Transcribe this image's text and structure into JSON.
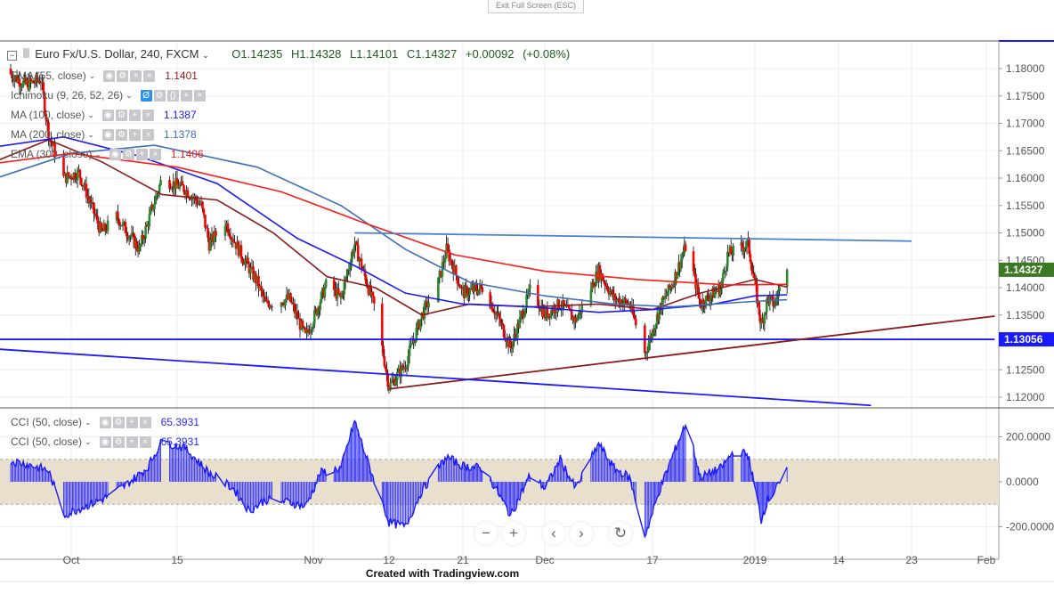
{
  "top_bar": {
    "exit_fullscreen": "Exit Full Screen (ESC)"
  },
  "header": {
    "symbol": "Euro Fx/U.S. Dollar, 240, FXCM",
    "open": "O1.14235",
    "high": "H1.14328",
    "low": "L1.14101",
    "close": "C1.14327",
    "change": "+0.00092 (+0.08%)"
  },
  "indicators": [
    {
      "label": "EMA (55, close)",
      "value": "1.1401",
      "color": "#a11b1b"
    },
    {
      "label": "Ichimoku (9, 26, 52, 26)",
      "value": "",
      "color": "#999999"
    },
    {
      "label": "MA (100, close)",
      "value": "1.1387",
      "color": "#1a1aff"
    },
    {
      "label": "MA (200, close)",
      "value": "1.1378",
      "color": "#3f6fb5"
    },
    {
      "label": "EMA (300, close)",
      "value": "1.1406",
      "color": "#ff1a1a"
    }
  ],
  "cci_panels": [
    {
      "label": "CCI (50, close)",
      "value": "65.3931"
    },
    {
      "label": "CCI (50, close)",
      "value": "65.3931"
    }
  ],
  "nav_buttons": {
    "zoom_out": "−",
    "zoom_in": "+",
    "scroll_left": "‹",
    "scroll_right": "›",
    "reset": "↻"
  },
  "credit": "Created with Tradingview.com",
  "chart_data": [
    {
      "type": "candlestick",
      "title": "Euro Fx/U.S. Dollar, 240, FXCM",
      "ylim": [
        1.118,
        1.1825
      ],
      "y_ticks": [
        "1.18000",
        "1.17500",
        "1.17000",
        "1.16500",
        "1.16000",
        "1.15500",
        "1.15000",
        "1.14500",
        "1.14000",
        "1.13500",
        "1.12500",
        "1.12000"
      ],
      "x_ticks": [
        {
          "label": "Oct",
          "date": "2018-10-01"
        },
        {
          "label": "15",
          "date": "2018-10-15"
        },
        {
          "label": "Nov",
          "date": "2018-11-01"
        },
        {
          "label": "12",
          "date": "2018-11-12"
        },
        {
          "label": "21",
          "date": "2018-11-21"
        },
        {
          "label": "Dec",
          "date": "2018-12-03"
        },
        {
          "label": "17",
          "date": "2018-12-17"
        },
        {
          "label": "2019",
          "date": "2019-01-01"
        },
        {
          "label": "14",
          "date": "2019-01-14"
        },
        {
          "label": "23",
          "date": "2019-01-23"
        },
        {
          "label": "Feb",
          "date": "2019-02-01"
        }
      ],
      "last_price_label": "1.14327",
      "level_label": "1.13056",
      "colors": {
        "up": "#2e8b2e",
        "down": "#ff0000",
        "last_price": "#3b7a22",
        "level": "#1a1aff"
      },
      "close_path": [
        [
          "2018-09-22",
          1.18
        ],
        [
          "2018-09-25",
          1.177
        ],
        [
          "2018-09-27",
          1.178
        ],
        [
          "2018-09-28",
          1.168
        ],
        [
          "2018-09-30",
          1.16
        ],
        [
          "2018-10-02",
          1.161
        ],
        [
          "2018-10-05",
          1.15
        ],
        [
          "2018-10-07",
          1.153
        ],
        [
          "2018-10-10",
          1.147
        ],
        [
          "2018-10-13",
          1.16
        ],
        [
          "2018-10-16",
          1.158
        ],
        [
          "2018-10-18",
          1.155
        ],
        [
          "2018-10-19",
          1.148
        ],
        [
          "2018-10-21",
          1.152
        ],
        [
          "2018-10-23",
          1.146
        ],
        [
          "2018-10-25",
          1.141
        ],
        [
          "2018-10-26",
          1.137
        ],
        [
          "2018-10-29",
          1.138
        ],
        [
          "2018-10-31",
          1.131
        ],
        [
          "2018-11-03",
          1.141
        ],
        [
          "2018-11-05",
          1.138
        ],
        [
          "2018-11-07",
          1.148
        ],
        [
          "2018-11-10",
          1.136
        ],
        [
          "2018-11-12",
          1.122
        ],
        [
          "2018-11-14",
          1.126
        ],
        [
          "2018-11-16",
          1.135
        ],
        [
          "2018-11-18",
          1.141
        ],
        [
          "2018-11-19",
          1.147
        ],
        [
          "2018-11-21",
          1.139
        ],
        [
          "2018-11-24",
          1.14
        ],
        [
          "2018-11-26",
          1.135
        ],
        [
          "2018-11-28",
          1.129
        ],
        [
          "2018-12-01",
          1.14
        ],
        [
          "2018-12-03",
          1.135
        ],
        [
          "2018-12-05",
          1.137
        ],
        [
          "2018-12-07",
          1.134
        ],
        [
          "2018-12-10",
          1.143
        ],
        [
          "2018-12-12",
          1.138
        ],
        [
          "2018-12-14",
          1.137
        ],
        [
          "2018-12-16",
          1.128
        ],
        [
          "2018-12-18",
          1.136
        ],
        [
          "2018-12-20",
          1.141
        ],
        [
          "2018-12-22",
          1.148
        ],
        [
          "2018-12-24",
          1.137
        ],
        [
          "2018-12-27",
          1.14
        ],
        [
          "2018-12-28",
          1.146
        ],
        [
          "2018-12-31",
          1.148
        ],
        [
          "2019-01-02",
          1.133
        ],
        [
          "2019-01-03",
          1.138
        ],
        [
          "2019-01-04",
          1.137
        ],
        [
          "2019-01-06",
          1.14327
        ]
      ],
      "moving_averages": [
        {
          "name": "EMA (55, close)",
          "color": "#8b1a1a",
          "points": [
            [
              "2018-09-20",
              1.1625
            ],
            [
              "2018-09-28",
              1.167
            ],
            [
              "2018-10-05",
              1.163
            ],
            [
              "2018-10-13",
              1.157
            ],
            [
              "2018-10-20",
              1.156
            ],
            [
              "2018-10-27",
              1.15
            ],
            [
              "2018-11-03",
              1.142
            ],
            [
              "2018-11-10",
              1.14
            ],
            [
              "2018-11-16",
              1.135
            ],
            [
              "2018-11-22",
              1.137
            ],
            [
              "2018-12-01",
              1.1365
            ],
            [
              "2018-12-10",
              1.137
            ],
            [
              "2018-12-17",
              1.136
            ],
            [
              "2018-12-24",
              1.139
            ],
            [
              "2019-01-01",
              1.1415
            ],
            [
              "2019-01-06",
              1.1401
            ]
          ]
        },
        {
          "name": "MA (100, close)",
          "color": "#1a1aff",
          "points": [
            [
              "2018-09-20",
              1.1655
            ],
            [
              "2018-09-30",
              1.1675
            ],
            [
              "2018-10-10",
              1.164
            ],
            [
              "2018-10-20",
              1.159
            ],
            [
              "2018-10-30",
              1.149
            ],
            [
              "2018-11-07",
              1.144
            ],
            [
              "2018-11-14",
              1.139
            ],
            [
              "2018-11-21",
              1.137
            ],
            [
              "2018-12-01",
              1.1365
            ],
            [
              "2018-12-10",
              1.1355
            ],
            [
              "2018-12-17",
              1.136
            ],
            [
              "2018-12-26",
              1.137
            ],
            [
              "2019-01-01",
              1.1385
            ],
            [
              "2019-01-06",
              1.1387
            ]
          ]
        },
        {
          "name": "MA (200, close)",
          "color": "#3f6fb5",
          "points": [
            [
              "2018-09-20",
              1.1595
            ],
            [
              "2018-10-01",
              1.1645
            ],
            [
              "2018-10-12",
              1.166
            ],
            [
              "2018-10-25",
              1.162
            ],
            [
              "2018-11-05",
              1.155
            ],
            [
              "2018-11-14",
              1.147
            ],
            [
              "2018-11-22",
              1.141
            ],
            [
              "2018-12-03",
              1.1385
            ],
            [
              "2018-12-12",
              1.137
            ],
            [
              "2018-12-20",
              1.1365
            ],
            [
              "2019-01-01",
              1.1375
            ],
            [
              "2019-01-06",
              1.1378
            ]
          ]
        },
        {
          "name": "EMA (300, close)",
          "color": "#ff1a1a",
          "points": [
            [
              "2018-09-20",
              1.1625
            ],
            [
              "2018-10-01",
              1.1645
            ],
            [
              "2018-10-15",
              1.162
            ],
            [
              "2018-10-28",
              1.1575
            ],
            [
              "2018-11-08",
              1.152
            ],
            [
              "2018-11-20",
              1.146
            ],
            [
              "2018-12-03",
              1.143
            ],
            [
              "2018-12-15",
              1.1415
            ],
            [
              "2018-12-28",
              1.1405
            ],
            [
              "2019-01-06",
              1.1406
            ]
          ]
        }
      ],
      "trendlines": [
        {
          "color": "#4a7fd4",
          "from": [
            "2018-11-07",
            1.15
          ],
          "to": [
            "2019-01-23",
            1.1485
          ]
        },
        {
          "color": "#1a1aff",
          "from": [
            "2018-09-21",
            1.13056
          ],
          "to": [
            "2019-02-02",
            1.13056
          ]
        },
        {
          "color": "#8b1a1a",
          "from": [
            "2018-11-12",
            1.1215
          ],
          "to": [
            "2019-02-02",
            1.1348
          ]
        },
        {
          "color": "#1a1aff",
          "from": [
            "2018-09-21",
            1.1288
          ],
          "to": [
            "2019-01-18",
            1.1185
          ]
        }
      ]
    },
    {
      "type": "area",
      "title": "CCI (50, close)",
      "ylim": [
        -260,
        300
      ],
      "y_ticks": [
        "200.0000",
        "0.0000",
        "-200.0000"
      ],
      "band": [
        -100,
        100
      ],
      "colors": {
        "line": "#1a1aff",
        "band": "#e8dfcc"
      },
      "points": [
        [
          "2018-09-22",
          100
        ],
        [
          "2018-09-25",
          80
        ],
        [
          "2018-09-28",
          50
        ],
        [
          "2018-09-30",
          -150
        ],
        [
          "2018-10-02",
          -120
        ],
        [
          "2018-10-05",
          -80
        ],
        [
          "2018-10-08",
          -20
        ],
        [
          "2018-10-11",
          60
        ],
        [
          "2018-10-13",
          180
        ],
        [
          "2018-10-16",
          150
        ],
        [
          "2018-10-19",
          40
        ],
        [
          "2018-10-22",
          -30
        ],
        [
          "2018-10-24",
          -130
        ],
        [
          "2018-10-26",
          -80
        ],
        [
          "2018-10-29",
          -90
        ],
        [
          "2018-10-31",
          -110
        ],
        [
          "2018-11-02",
          40
        ],
        [
          "2018-11-05",
          60
        ],
        [
          "2018-11-07",
          270
        ],
        [
          "2018-11-09",
          80
        ],
        [
          "2018-11-12",
          -180
        ],
        [
          "2018-11-14",
          -200
        ],
        [
          "2018-11-16",
          -40
        ],
        [
          "2018-11-19",
          110
        ],
        [
          "2018-11-21",
          70
        ],
        [
          "2018-11-24",
          60
        ],
        [
          "2018-11-26",
          -40
        ],
        [
          "2018-11-28",
          -150
        ],
        [
          "2018-12-01",
          40
        ],
        [
          "2018-12-03",
          -30
        ],
        [
          "2018-12-05",
          100
        ],
        [
          "2018-12-07",
          -30
        ],
        [
          "2018-12-10",
          170
        ],
        [
          "2018-12-12",
          60
        ],
        [
          "2018-12-14",
          20
        ],
        [
          "2018-12-16",
          -240
        ],
        [
          "2018-12-18",
          -40
        ],
        [
          "2018-12-20",
          120
        ],
        [
          "2018-12-22",
          270
        ],
        [
          "2018-12-24",
          20
        ],
        [
          "2018-12-27",
          60
        ],
        [
          "2018-12-29",
          140
        ],
        [
          "2018-12-31",
          120
        ],
        [
          "2019-01-02",
          -170
        ],
        [
          "2019-01-03",
          -80
        ],
        [
          "2019-01-04",
          -50
        ],
        [
          "2019-01-06",
          65.3931
        ]
      ]
    }
  ]
}
